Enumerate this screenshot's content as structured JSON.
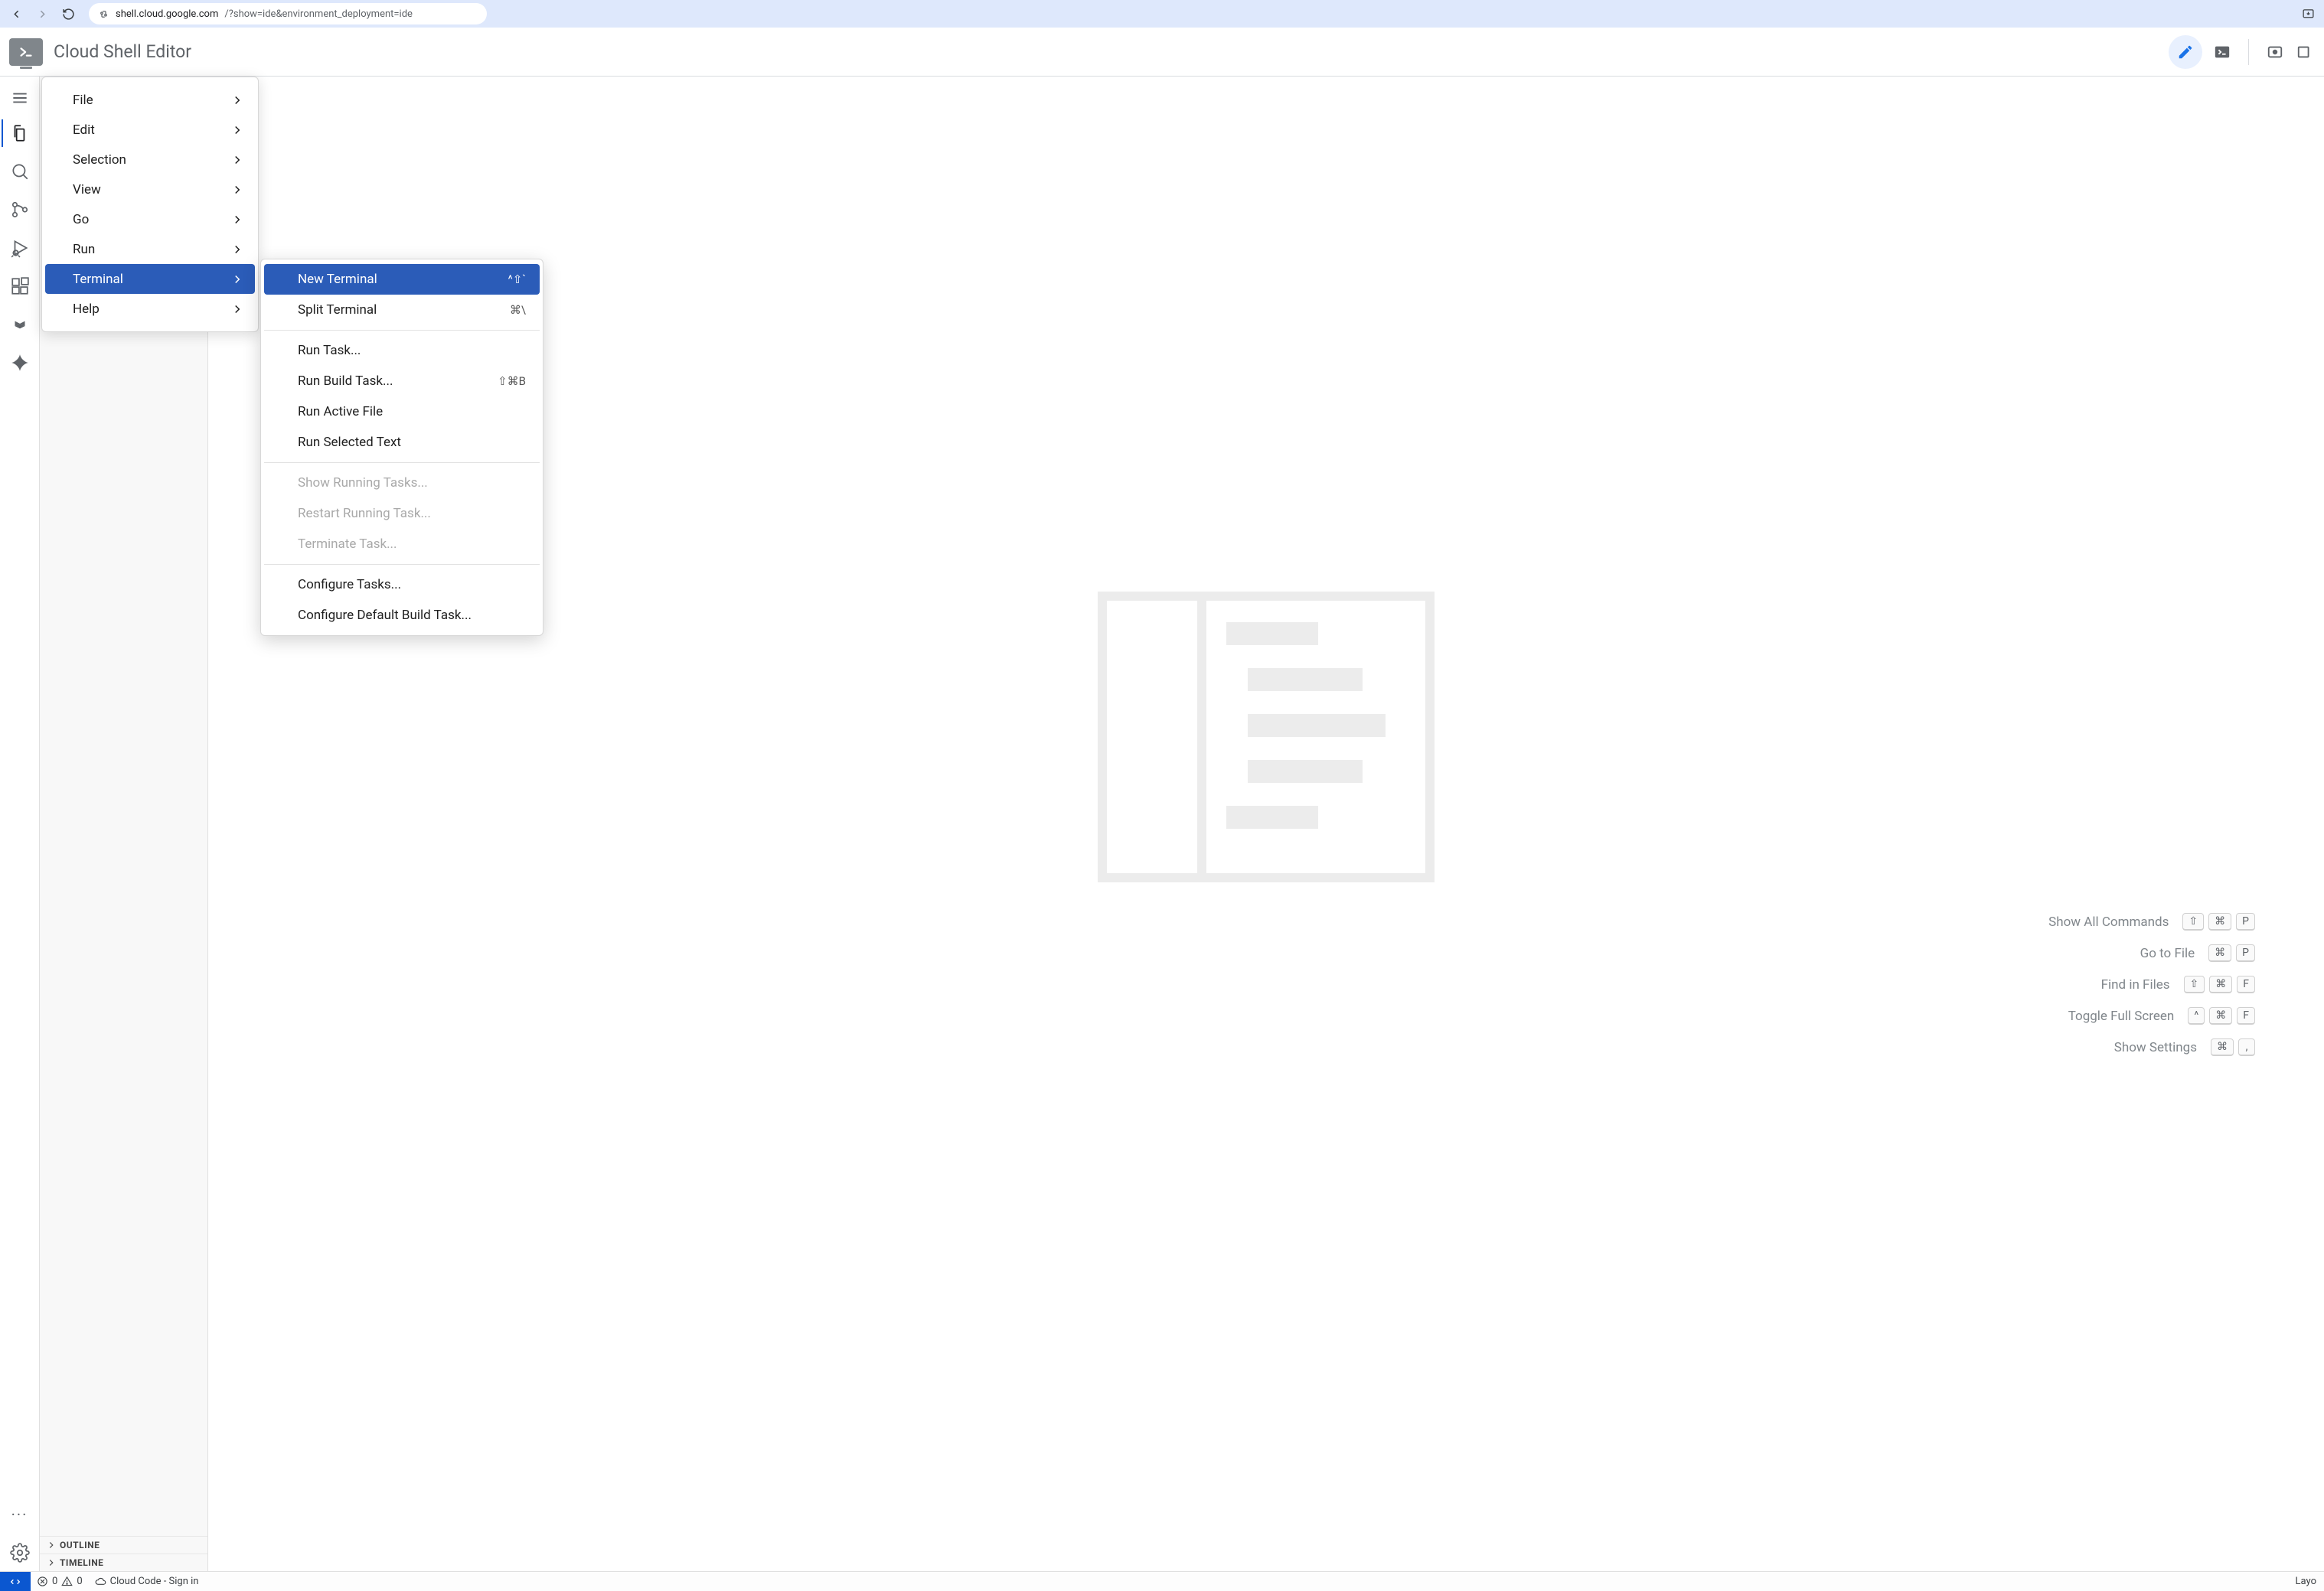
{
  "browser": {
    "url_host": "shell.cloud.google.com",
    "url_path": "/?show=ide&environment_deployment=ide"
  },
  "header": {
    "title": "Cloud Shell Editor"
  },
  "activity": {
    "items": [
      "menu",
      "explorer",
      "search",
      "source-control",
      "run-debug",
      "extensions",
      "cloud-code",
      "gemini"
    ]
  },
  "side_panel": {
    "outline": "OUTLINE",
    "timeline": "TIMELINE"
  },
  "commands": [
    {
      "label": "Show All Commands",
      "keys": [
        "⇧",
        "⌘",
        "P"
      ]
    },
    {
      "label": "Go to File",
      "keys": [
        "⌘",
        "P"
      ]
    },
    {
      "label": "Find in Files",
      "keys": [
        "⇧",
        "⌘",
        "F"
      ]
    },
    {
      "label": "Toggle Full Screen",
      "keys": [
        "^",
        "⌘",
        "F"
      ]
    },
    {
      "label": "Show Settings",
      "keys": [
        "⌘",
        ","
      ]
    }
  ],
  "menu1_items": [
    {
      "label": "File"
    },
    {
      "label": "Edit"
    },
    {
      "label": "Selection"
    },
    {
      "label": "View"
    },
    {
      "label": "Go"
    },
    {
      "label": "Run"
    },
    {
      "label": "Terminal",
      "highlight": true
    },
    {
      "label": "Help"
    }
  ],
  "menu2_groups": [
    [
      {
        "label": "New Terminal",
        "kb": "^⇧`",
        "highlight": true
      },
      {
        "label": "Split Terminal",
        "kb": "⌘\\"
      }
    ],
    [
      {
        "label": "Run Task..."
      },
      {
        "label": "Run Build Task...",
        "kb": "⇧⌘B"
      },
      {
        "label": "Run Active File"
      },
      {
        "label": "Run Selected Text"
      }
    ],
    [
      {
        "label": "Show Running Tasks...",
        "disabled": true
      },
      {
        "label": "Restart Running Task...",
        "disabled": true
      },
      {
        "label": "Terminate Task...",
        "disabled": true
      }
    ],
    [
      {
        "label": "Configure Tasks..."
      },
      {
        "label": "Configure Default Build Task..."
      }
    ]
  ],
  "status": {
    "errors": "0",
    "warnings": "0",
    "cloud_code": "Cloud Code - Sign in",
    "right": "Layo"
  }
}
